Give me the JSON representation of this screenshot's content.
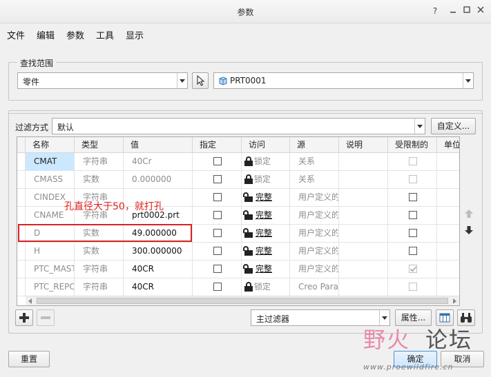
{
  "window": {
    "title": "参数"
  },
  "menu": [
    "文件",
    "编辑",
    "参数",
    "工具",
    "显示"
  ],
  "lookin": {
    "legend": "查找范围",
    "type_value": "零件",
    "model_value": "PRT0001"
  },
  "filter": {
    "label": "过滤方式",
    "value": "默认",
    "customize_label": "自定义..."
  },
  "table": {
    "columns": [
      "名称",
      "类型",
      "值",
      "指定",
      "访问",
      "源",
      "说明",
      "受限制的",
      "单位"
    ],
    "rows": [
      {
        "name": "CMAT",
        "type": "字符串",
        "value": "40Cr",
        "access": "锁定",
        "access_state": "locked",
        "source": "关系",
        "restricted": false,
        "restricted_disabled": true,
        "value_editable": false,
        "selected": true
      },
      {
        "name": "CMASS",
        "type": "实数",
        "value": "0.000000",
        "access": "锁定",
        "access_state": "locked",
        "source": "关系",
        "restricted": false,
        "restricted_disabled": true,
        "value_editable": false,
        "selected": false
      },
      {
        "name": "CINDEX",
        "type": "字符串",
        "value": "",
        "access": "完整",
        "access_state": "full",
        "source": "用户定义的",
        "restricted": false,
        "restricted_disabled": false,
        "value_editable": true,
        "selected": false
      },
      {
        "name": "CNAME",
        "type": "字符串",
        "value": "prt0002.prt",
        "access": "完整",
        "access_state": "full",
        "source": "用户定义的",
        "restricted": false,
        "restricted_disabled": false,
        "value_editable": true,
        "selected": false
      },
      {
        "name": "D",
        "type": "实数",
        "value": "49.000000",
        "access": "完整",
        "access_state": "full",
        "source": "用户定义的",
        "restricted": false,
        "restricted_disabled": false,
        "value_editable": true,
        "selected": false
      },
      {
        "name": "H",
        "type": "实数",
        "value": "300.000000",
        "access": "完整",
        "access_state": "full",
        "source": "用户定义的",
        "restricted": false,
        "restricted_disabled": false,
        "value_editable": true,
        "selected": false
      },
      {
        "name": "PTC_MASTER",
        "type": "字符串",
        "value": "40CR",
        "access": "完整",
        "access_state": "full",
        "source": "用户定义的",
        "restricted": true,
        "restricted_disabled": true,
        "value_editable": true,
        "selected": false
      },
      {
        "name": "PTC_REPORT",
        "type": "字符串",
        "value": "40CR",
        "access": "锁定",
        "access_state": "locked",
        "source": "Creo Parameters",
        "restricted": false,
        "restricted_disabled": true,
        "value_editable": true,
        "selected": false
      }
    ]
  },
  "annotation": {
    "text": "孔直径大于50，就打孔"
  },
  "bottom_toolbar": {
    "main_filter": "主过滤器",
    "properties_label": "属性..."
  },
  "footer": {
    "reset_label": "重置",
    "ok_label": "确定",
    "cancel_label": "取消"
  },
  "watermark": {
    "part1": "野火",
    "part2": "论坛",
    "url": "www.proewildfire.cn"
  }
}
